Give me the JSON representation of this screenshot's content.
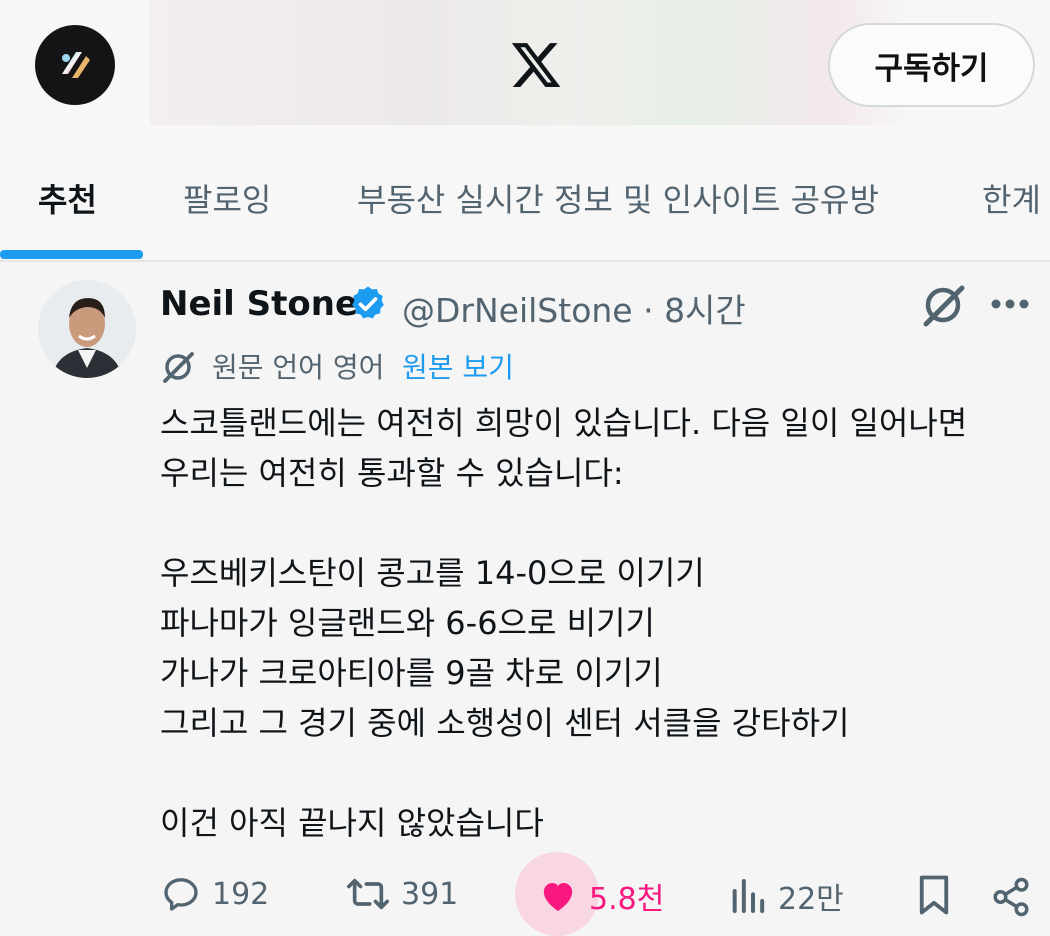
{
  "header": {
    "logo": "x-logo-icon",
    "subscribe_label": "구독하기"
  },
  "tabs": [
    {
      "label": "추천",
      "active": true
    },
    {
      "label": "팔로잉",
      "active": false
    },
    {
      "label": "부동산 실시간 정보 및 인사이트 공유방",
      "active": false
    },
    {
      "label": "한계",
      "active": false
    }
  ],
  "post": {
    "author_name": "Neil Stone",
    "handle_time": "@DrNeilStone · 8시간",
    "translation_label": "원문 언어 영어",
    "translation_link": "원본 보기",
    "lines": [
      "스코틀랜드에는 여전히 희망이 있습니다. 다음 일이 일어나면",
      "우리는 여전히 통과할 수 있습니다:",
      "",
      "우즈베키스탄이 콩고를 14-0으로 이기기",
      "파나마가 잉글랜드와 6-6으로 비기기",
      "가나가 크로아티아를 9골 차로 이기기",
      "그리고 그 경기 중에 소행성이 센터 서클을 강타하기",
      "",
      "이건 아직 끝나지 않았습니다"
    ],
    "stats": {
      "replies": "192",
      "reposts": "391",
      "likes": "5.8천",
      "views": "22만"
    }
  },
  "colors": {
    "accent": "#1d9bf0",
    "like": "#f91880",
    "muted": "#536471"
  }
}
